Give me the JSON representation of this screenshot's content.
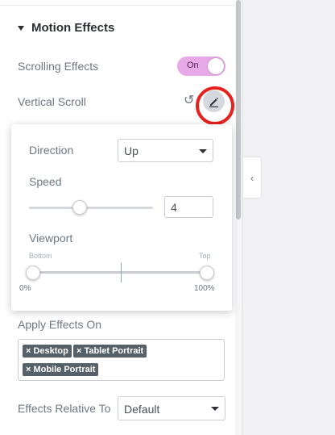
{
  "section": {
    "title": "Motion Effects"
  },
  "scrolling_effects": {
    "label": "Scrolling Effects",
    "toggle_text": "On",
    "toggle_on": true
  },
  "vertical_scroll": {
    "label": "Vertical Scroll"
  },
  "popover": {
    "direction": {
      "label": "Direction",
      "value": "Up"
    },
    "speed": {
      "label": "Speed",
      "value": "4",
      "slider_fraction": 0.4
    },
    "viewport": {
      "label": "Viewport",
      "bottom_label": "Bottom",
      "top_label": "Top",
      "start_value": "0%",
      "end_value": "100%",
      "start": 0,
      "end": 100
    }
  },
  "apply_effects": {
    "label": "Apply Effects On",
    "tags": [
      {
        "label": "Desktop"
      },
      {
        "label": "Tablet Portrait"
      },
      {
        "label": "Mobile Portrait"
      }
    ]
  },
  "relative_to": {
    "label": "Effects Relative To",
    "value": "Default"
  },
  "icons": {
    "reset": "reset-icon",
    "edit": "pencil-icon",
    "collapse": "chevron-left-icon",
    "tag_remove": "close-icon"
  },
  "colors": {
    "toggle_on": "#e8a9e8",
    "highlight": "#e8201e",
    "tag_bg": "#556068"
  }
}
